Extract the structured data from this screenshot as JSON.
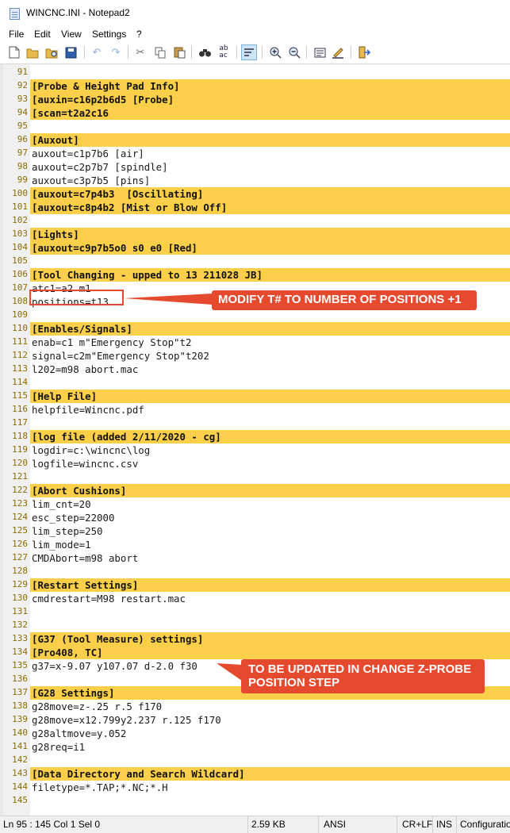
{
  "window": {
    "title": "WINCNC.INI - Notepad2"
  },
  "menu": {
    "items": [
      "File",
      "Edit",
      "View",
      "Settings",
      "?"
    ]
  },
  "toolbar": {
    "buttons": [
      "new-file",
      "open-file",
      "browse",
      "save",
      "undo",
      "redo",
      "cut",
      "copy",
      "paste",
      "find",
      "replace",
      "word-wrap",
      "zoom-in",
      "zoom-out",
      "scheme",
      "customize-schemes",
      "exit"
    ]
  },
  "editor": {
    "highlight_color": "#fbcf4a",
    "lines": [
      {
        "num": "91",
        "text": "",
        "hl": false
      },
      {
        "num": "92",
        "text": "[Probe & Height Pad Info]",
        "hl": true
      },
      {
        "num": "93",
        "text": "[auxin=c16p2b6d5 [Probe]",
        "hl": true
      },
      {
        "num": "94",
        "text": "[scan=t2a2c16",
        "hl": true
      },
      {
        "num": "95",
        "text": "",
        "hl": false
      },
      {
        "num": "96",
        "text": "[Auxout]",
        "hl": true
      },
      {
        "num": "97",
        "text": "auxout=c1p7b6 [air]",
        "hl": false
      },
      {
        "num": "98",
        "text": "auxout=c2p7b7 [spindle]",
        "hl": false
      },
      {
        "num": "99",
        "text": "auxout=c3p7b5 [pins]",
        "hl": false
      },
      {
        "num": "100",
        "text": "[auxout=c7p4b3  [Oscillating]",
        "hl": true
      },
      {
        "num": "101",
        "text": "[auxout=c8p4b2 [Mist or Blow Off]",
        "hl": true
      },
      {
        "num": "102",
        "text": "",
        "hl": false
      },
      {
        "num": "103",
        "text": "[Lights]",
        "hl": true
      },
      {
        "num": "104",
        "text": "[auxout=c9p7b5o0 s0 e0 [Red]",
        "hl": true
      },
      {
        "num": "105",
        "text": "",
        "hl": false
      },
      {
        "num": "106",
        "text": "[Tool Changing - upped to 13 211028 JB]",
        "hl": true
      },
      {
        "num": "107",
        "text": "atc1=a2 m1",
        "hl": false
      },
      {
        "num": "108",
        "text": "positions=t13",
        "hl": false
      },
      {
        "num": "109",
        "text": "",
        "hl": false
      },
      {
        "num": "110",
        "text": "[Enables/Signals]",
        "hl": true
      },
      {
        "num": "111",
        "text": "enab=c1 m\"Emergency Stop\"t2",
        "hl": false
      },
      {
        "num": "112",
        "text": "signal=c2m\"Emergency Stop\"t202",
        "hl": false
      },
      {
        "num": "113",
        "text": "l202=m98 abort.mac",
        "hl": false
      },
      {
        "num": "114",
        "text": "",
        "hl": false
      },
      {
        "num": "115",
        "text": "[Help File]",
        "hl": true
      },
      {
        "num": "116",
        "text": "helpfile=Wincnc.pdf",
        "hl": false
      },
      {
        "num": "117",
        "text": "",
        "hl": false
      },
      {
        "num": "118",
        "text": "[log file (added 2/11/2020 - cg]",
        "hl": true
      },
      {
        "num": "119",
        "text": "logdir=c:\\wincnc\\log",
        "hl": false
      },
      {
        "num": "120",
        "text": "logfile=wincnc.csv",
        "hl": false
      },
      {
        "num": "121",
        "text": "",
        "hl": false
      },
      {
        "num": "122",
        "text": "[Abort Cushions]",
        "hl": true
      },
      {
        "num": "123",
        "text": "lim_cnt=20",
        "hl": false
      },
      {
        "num": "124",
        "text": "esc_step=22000",
        "hl": false
      },
      {
        "num": "125",
        "text": "lim_step=250",
        "hl": false
      },
      {
        "num": "126",
        "text": "lim_mode=1",
        "hl": false
      },
      {
        "num": "127",
        "text": "CMDAbort=m98 abort",
        "hl": false
      },
      {
        "num": "128",
        "text": "",
        "hl": false
      },
      {
        "num": "129",
        "text": "[Restart Settings]",
        "hl": true
      },
      {
        "num": "130",
        "text": "cmdrestart=M98 restart.mac",
        "hl": false
      },
      {
        "num": "131",
        "text": "",
        "hl": false
      },
      {
        "num": "132",
        "text": "",
        "hl": false
      },
      {
        "num": "133",
        "text": "[G37 (Tool Measure) settings]",
        "hl": true
      },
      {
        "num": "134",
        "text": "[Pro408, TC]",
        "hl": true
      },
      {
        "num": "135",
        "text": "g37=x-9.07 y107.07 d-2.0 f30",
        "hl": false
      },
      {
        "num": "136",
        "text": "",
        "hl": false
      },
      {
        "num": "137",
        "text": "[G28 Settings]",
        "hl": true
      },
      {
        "num": "138",
        "text": "g28move=z-.25 r.5 f170",
        "hl": false
      },
      {
        "num": "139",
        "text": "g28move=x12.799y2.237 r.125 f170",
        "hl": false
      },
      {
        "num": "140",
        "text": "g28altmove=y.052",
        "hl": false
      },
      {
        "num": "141",
        "text": "g28req=i1",
        "hl": false
      },
      {
        "num": "142",
        "text": "",
        "hl": false
      },
      {
        "num": "143",
        "text": "[Data Directory and Search Wildcard]",
        "hl": true
      },
      {
        "num": "144",
        "text": "filetype=*.TAP;*.NC;*.H",
        "hl": false
      },
      {
        "num": "145",
        "text": "",
        "hl": false
      }
    ]
  },
  "annotations": {
    "callout1": "MODIFY T# TO NUMBER OF POSITIONS +1",
    "callout2_line1": "TO BE UPDATED IN CHANGE Z-PROBE",
    "callout2_line2": "POSITION STEP",
    "color": "#e64a2e"
  },
  "status": {
    "position": "Ln 95 : 145   Col 1   Sel 0",
    "size": "2.59 KB",
    "encoding": "ANSI",
    "line_ending": "CR+LF",
    "mode": "INS",
    "scheme": "Configuration"
  }
}
